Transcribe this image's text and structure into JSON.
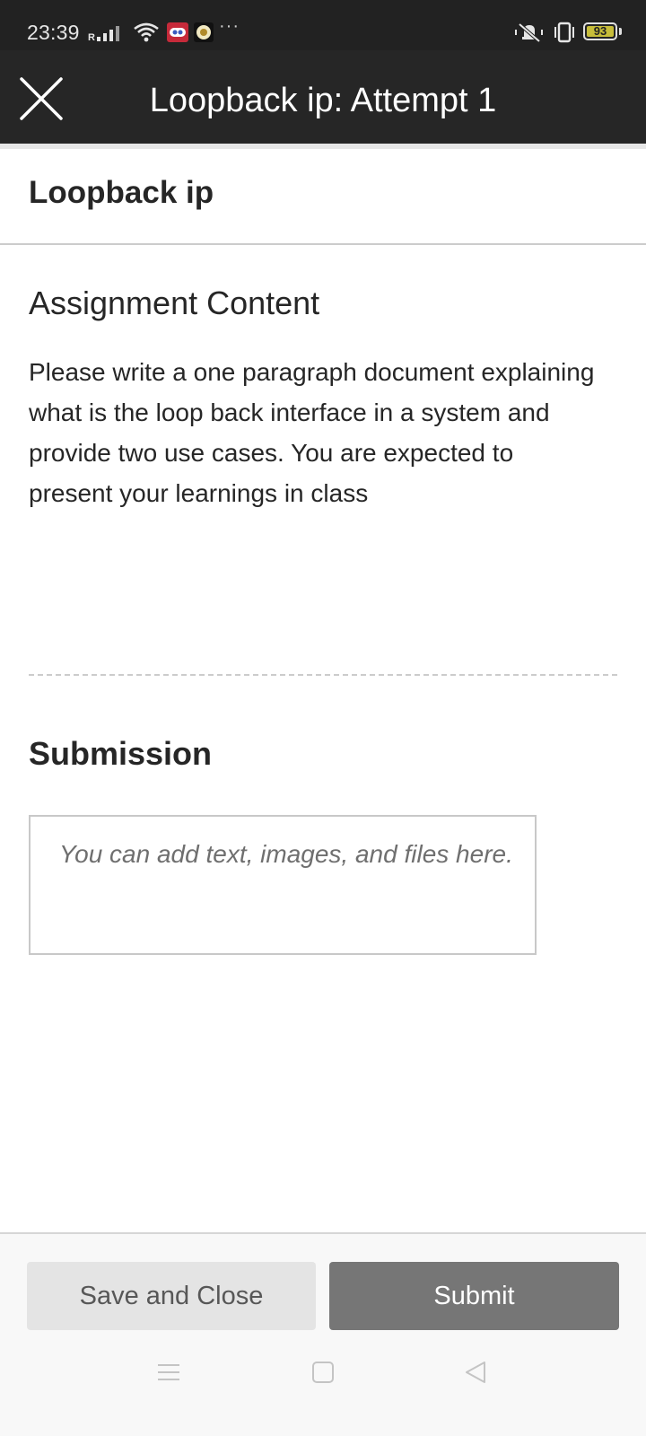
{
  "status_bar": {
    "time": "23:39",
    "battery_level": "93",
    "overflow_indicator": "···",
    "icons": [
      "signal-icon",
      "wifi-icon",
      "app-notification-icon",
      "app-notification-icon-2",
      "silent-icon",
      "vibrate-icon",
      "battery-icon"
    ]
  },
  "header": {
    "title": "Loopback ip: Attempt 1",
    "close_icon": "close-icon"
  },
  "assignment": {
    "name": "Loopback ip",
    "content_heading": "Assignment Content",
    "content_text": "Please write a one paragraph document explaining what is the loop back interface in a system and provide two use cases. You are expected to present your learnings in class"
  },
  "submission": {
    "heading": "Submission",
    "placeholder": "You can add text, images, and files here."
  },
  "footer": {
    "save_label": "Save and Close",
    "submit_label": "Submit"
  },
  "nav_bar": {
    "icons": [
      "menu-icon",
      "home-icon",
      "back-icon"
    ]
  },
  "colors": {
    "header_bg": "#262626",
    "submit_bg": "#767676",
    "save_bg": "#e4e4e4",
    "battery_fill": "#c7bd3a"
  }
}
